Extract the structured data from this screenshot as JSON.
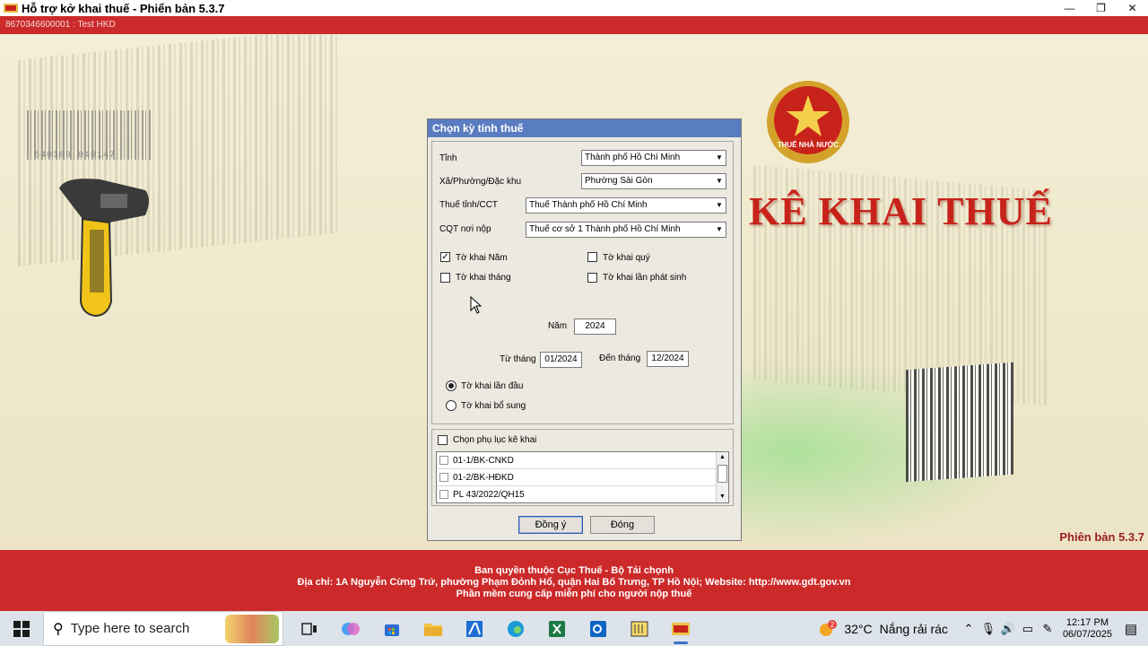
{
  "window": {
    "title": "Hỗ trợ kở khai thuế -  Phiển bản 5.3.7",
    "account": "8670346600001 : Test HKD",
    "controls": {
      "minimize": "—",
      "restore": "❐",
      "close": "✕"
    }
  },
  "background": {
    "barcode_number": "640309 040147",
    "emblem_text": "THUẾ NHÀ NƯỚC",
    "headline": "KÊ KHAI THUẾ",
    "version": "Phiên bản 5.3.7"
  },
  "footer": {
    "line1": "Ban quyền thuộc Cục Thuế - Bộ Tải chọnh",
    "line2": "Địa chỉ: 1A Nguyễn Cừng Trứ, phường Phạm Đỏnh Hổ, quận Hai Bố Trưng, TP Hồ Nội; Website: http://www.gdt.gov.vn",
    "line3": "Phần mềm cung cấp miễn phí cho người nộp thuế"
  },
  "dialog": {
    "title": "Chọn kỳ tính thuế",
    "fields": {
      "tinh_label": "Tỉnh",
      "tinh_value": "Thành phố Hồ Chí Minh",
      "xa_label": "Xã/Phường/Đặc khu",
      "xa_value": "Phường Sài Gòn",
      "thue_tinh_label": "Thuế tỉnh/CCT",
      "thue_tinh_value": "Thuế Thành phố Hồ Chí Minh",
      "cqt_label": "CQT nơi nộp",
      "cqt_value": "Thuế cơ sở 1 Thành phố Hồ Chí Minh"
    },
    "checkboxes": {
      "nam": {
        "label": "Tờ khai Năm",
        "checked": true
      },
      "quy": {
        "label": "Tờ khai quý",
        "checked": false
      },
      "thang": {
        "label": "Tờ khai tháng",
        "checked": false
      },
      "lan_phat_sinh": {
        "label": "Tờ khai lần phát sinh",
        "checked": false
      }
    },
    "year_label": "Năm",
    "year_value": "2024",
    "from_label": "Từ tháng",
    "from_value": "01/2024",
    "to_label": "Đến tháng",
    "to_value": "12/2024",
    "radios": {
      "lan_dau": {
        "label": "Tờ khai lần đầu",
        "selected": true
      },
      "bo_sung": {
        "label": "Tờ khai bổ sung",
        "selected": false
      }
    },
    "appendix_label": "Chọn phụ lục kê khai",
    "appendix_items": [
      "01-1/BK-CNKD",
      "01-2/BK-HĐKD",
      "PL 43/2022/QH15"
    ],
    "ok_button": "Đồng ý",
    "close_button": "Đóng"
  },
  "taskbar": {
    "search_placeholder": "Type here to search",
    "temperature": "32°C",
    "weather": "Nắng rải rác",
    "time": "12:17 PM",
    "date": "06/07/2025",
    "notification_badge": "2"
  }
}
